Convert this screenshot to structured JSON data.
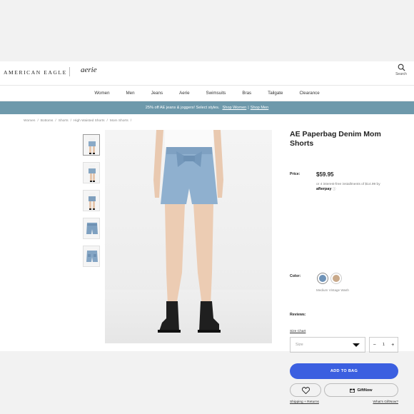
{
  "header": {
    "brand": "AMERICAN EAGLE",
    "sub_brand": "aerie",
    "search_label": "Search"
  },
  "nav": {
    "items": [
      {
        "label": "Women"
      },
      {
        "label": "Men"
      },
      {
        "label": "Jeans"
      },
      {
        "label": "Aerie"
      },
      {
        "label": "Swimsuits"
      },
      {
        "label": "Bras"
      },
      {
        "label": "Tailgate"
      },
      {
        "label": "Clearance"
      }
    ]
  },
  "promo": {
    "text": "25% off AE jeans & joggers! Select styles.",
    "link_women": "Shop Women",
    "separator": "|",
    "link_men": "Shop Men"
  },
  "breadcrumb": {
    "items": [
      "Women",
      "Bottoms",
      "Shorts",
      "High Waisted Shorts",
      "Mom Shorts"
    ],
    "separator": "/"
  },
  "product": {
    "title": "AE Paperbag Denim Mom Shorts",
    "price_label": "Price:",
    "price": "$59.95",
    "installments": "or 4 interest-free installments of $14.99 by",
    "afterpay": "afterpay",
    "afterpay_info": "ⓘ",
    "color_label": "Color:",
    "color_name": "Medium Vintage Wash",
    "reviews_label": "Reviews:",
    "size_chart": "Size Chart",
    "size_placeholder": "Size",
    "qty_minus": "−",
    "qty_value": "1",
    "qty_plus": "+",
    "add_to_bag": "ADD TO BAG",
    "giftnow": "GiftNow",
    "shipping_link": "Shipping + Returns",
    "giftnow_link": "What's GiftNow?"
  },
  "colors": {
    "accent_blue": "#3b5fe0",
    "promo_bg": "#6e99ab",
    "swatch_denim": "#6f93b8",
    "swatch_tan": "#c9a98a"
  },
  "icons": {
    "search": "search-icon",
    "heart": "heart-icon",
    "gift": "gift-icon",
    "caret": "caret-down-icon"
  }
}
